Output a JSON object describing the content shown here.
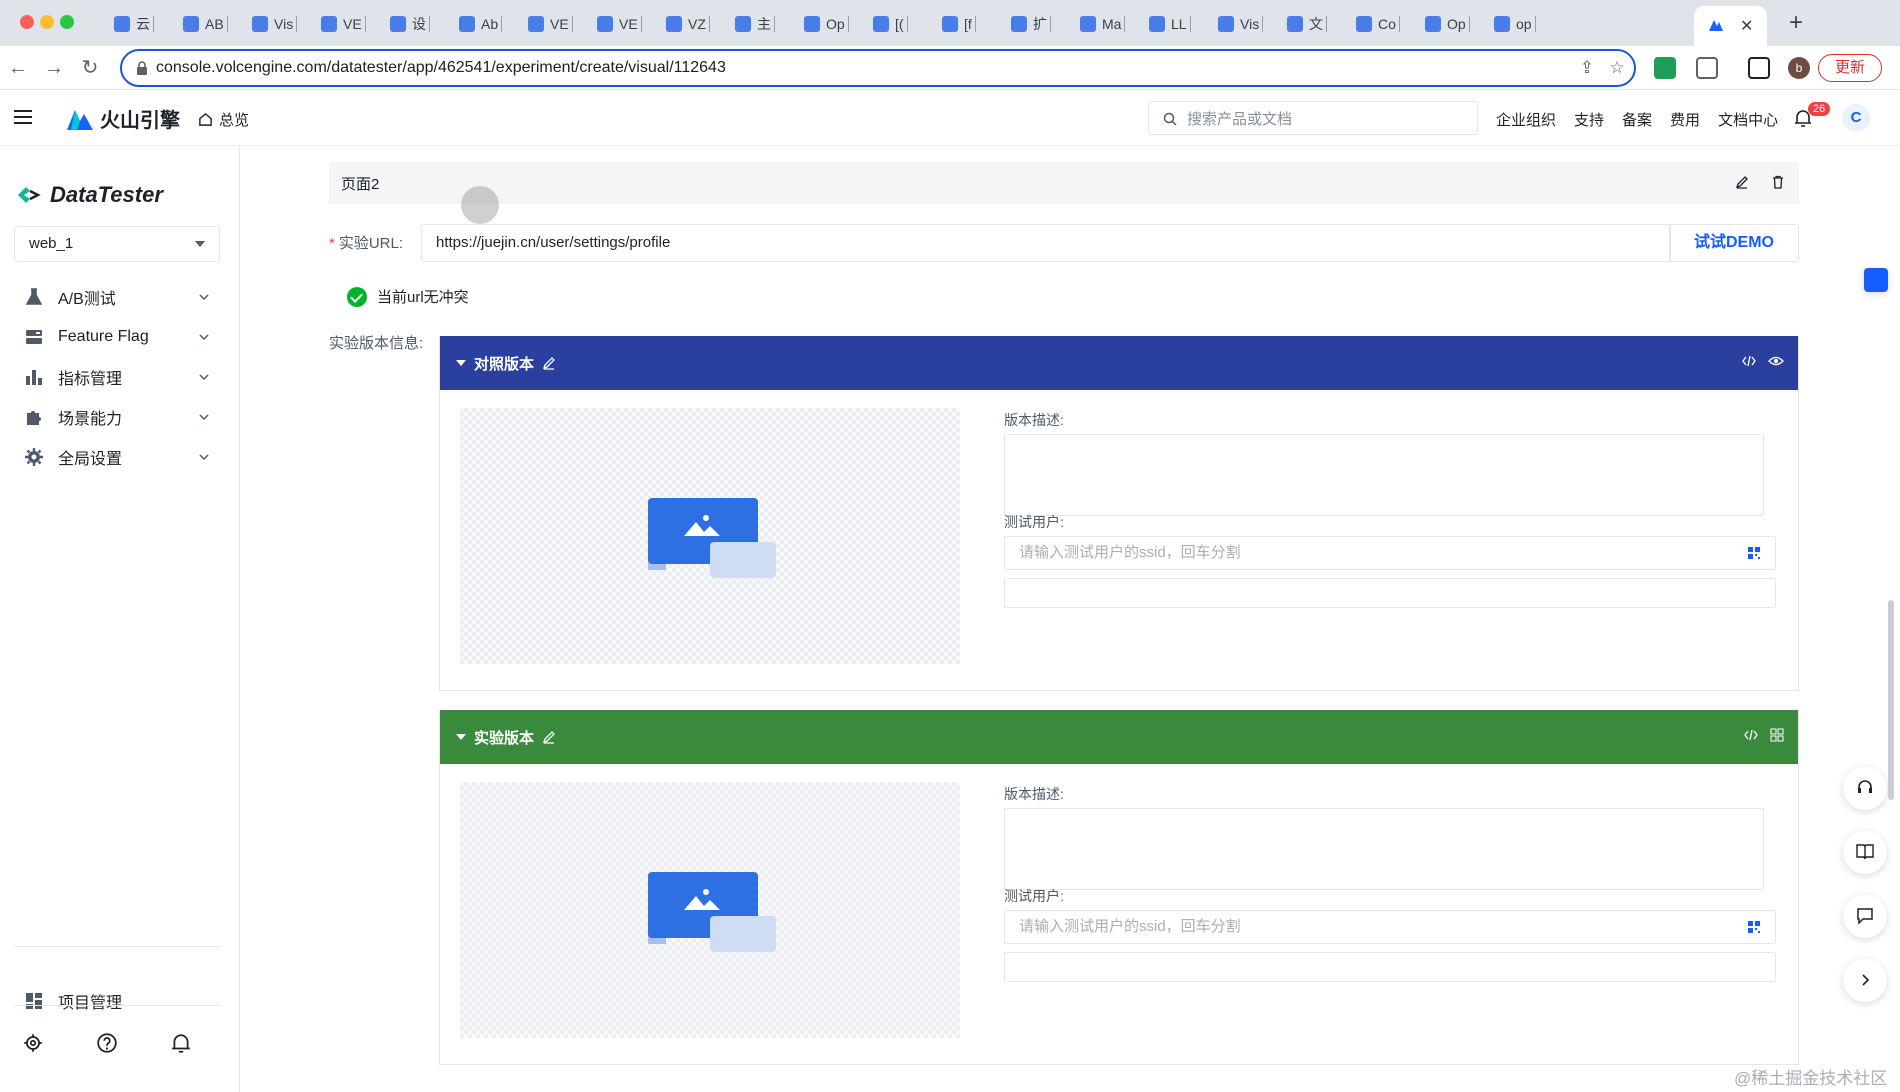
{
  "browser": {
    "tabs": [
      {
        "label": "云"
      },
      {
        "label": "AB"
      },
      {
        "label": "Vis"
      },
      {
        "label": "VE"
      },
      {
        "label": "设"
      },
      {
        "label": "Ab"
      },
      {
        "label": "VE"
      },
      {
        "label": "VE"
      },
      {
        "label": "VZ"
      },
      {
        "label": "主"
      },
      {
        "label": "Op"
      },
      {
        "label": "[("
      },
      {
        "label": "[f"
      },
      {
        "label": "扩"
      },
      {
        "label": "Ma"
      },
      {
        "label": "LL"
      },
      {
        "label": "Vis"
      },
      {
        "label": "文"
      },
      {
        "label": "Co"
      },
      {
        "label": "Op"
      },
      {
        "label": "op"
      }
    ],
    "url": "console.volcengine.com/datatester/app/462541/experiment/create/visual/112643",
    "update_label": "更新"
  },
  "header": {
    "brand": "火山引擎",
    "home": "总览",
    "search_placeholder": "搜索产品或文档",
    "links": [
      "企业组织",
      "支持",
      "备案",
      "费用",
      "文档中心"
    ],
    "notify_count": "26",
    "avatar": "C"
  },
  "sidebar": {
    "logo": "DataTester",
    "project": "web_1",
    "items": [
      {
        "label": "A/B测试",
        "icon": "flask-icon"
      },
      {
        "label": "Feature Flag",
        "icon": "flag-icon"
      },
      {
        "label": "指标管理",
        "icon": "bar-chart-icon"
      },
      {
        "label": "场景能力",
        "icon": "puzzle-icon"
      },
      {
        "label": "全局设置",
        "icon": "gear-icon"
      }
    ],
    "project_mgmt": "项目管理"
  },
  "main": {
    "page_name": "页面2",
    "url_label": "实验URL:",
    "url_value": "https://juejin.cn/user/settings/profile",
    "demo_button": "试试DEMO",
    "no_conflict": "当前url无冲突",
    "version_info_label": "实验版本信息:",
    "versions": [
      {
        "name": "对照版本",
        "color": "#2b3f9e",
        "desc_label": "版本描述:",
        "user_label": "测试用户:",
        "user_placeholder": "请输入测试用户的ssid，回车分割"
      },
      {
        "name": "实验版本",
        "color": "#3a8a3e",
        "desc_label": "版本描述:",
        "user_label": "测试用户:",
        "user_placeholder": "请输入测试用户的ssid，回车分割"
      }
    ]
  },
  "watermark": "@稀土掘金技术社区"
}
